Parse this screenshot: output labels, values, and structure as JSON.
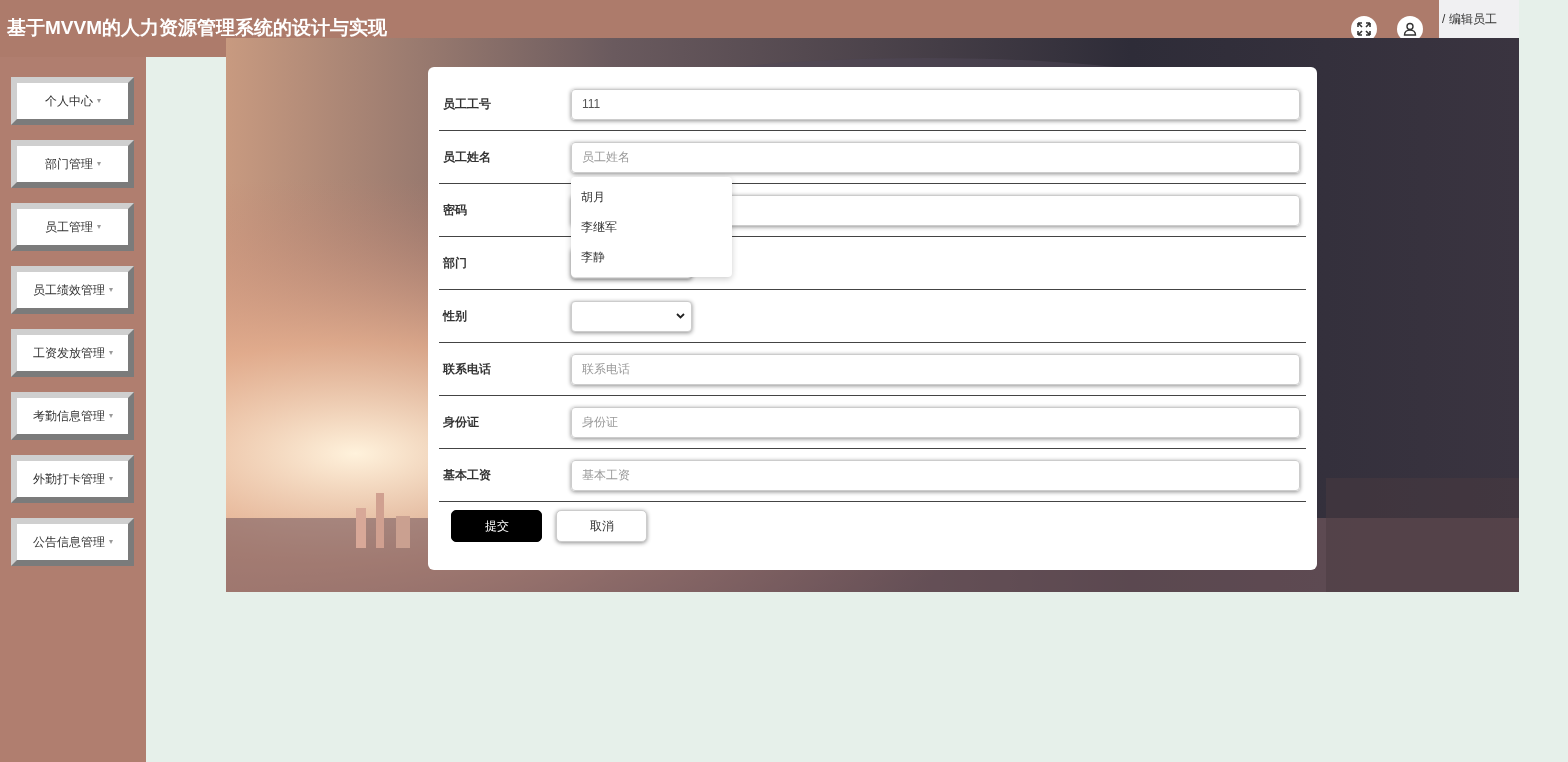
{
  "header": {
    "title": "基于MVVM的人力资源管理系统的设计与实现"
  },
  "breadcrumb": "/ 编辑员工",
  "sidebar": {
    "items": [
      {
        "label": "个人中心",
        "caret": "▾"
      },
      {
        "label": "部门管理",
        "caret": "▾"
      },
      {
        "label": "员工管理",
        "caret": "▾"
      },
      {
        "label": "员工绩效管理",
        "caret": "▾"
      },
      {
        "label": "工资发放管理",
        "caret": "▾"
      },
      {
        "label": "考勤信息管理",
        "caret": "▾"
      },
      {
        "label": "外勤打卡管理",
        "caret": "▾"
      },
      {
        "label": "公告信息管理",
        "caret": "▾"
      }
    ]
  },
  "form": {
    "fields": [
      {
        "label": "员工工号",
        "kind": "text",
        "value": "111"
      },
      {
        "label": "员工姓名",
        "kind": "text",
        "placeholder": "员工姓名",
        "suggestions": [
          "胡月",
          "李继军",
          "李静"
        ]
      },
      {
        "label": "密码",
        "kind": "text"
      },
      {
        "label": "部门",
        "kind": "select"
      },
      {
        "label": "性别",
        "kind": "select"
      },
      {
        "label": "联系电话",
        "kind": "text",
        "placeholder": "联系电话"
      },
      {
        "label": "身份证",
        "kind": "text",
        "placeholder": "身份证"
      },
      {
        "label": "基本工资",
        "kind": "text",
        "placeholder": "基本工资"
      }
    ],
    "buttons": [
      {
        "label": "提交",
        "kind": "primary"
      },
      {
        "label": "取消",
        "kind": "secondary"
      }
    ]
  }
}
